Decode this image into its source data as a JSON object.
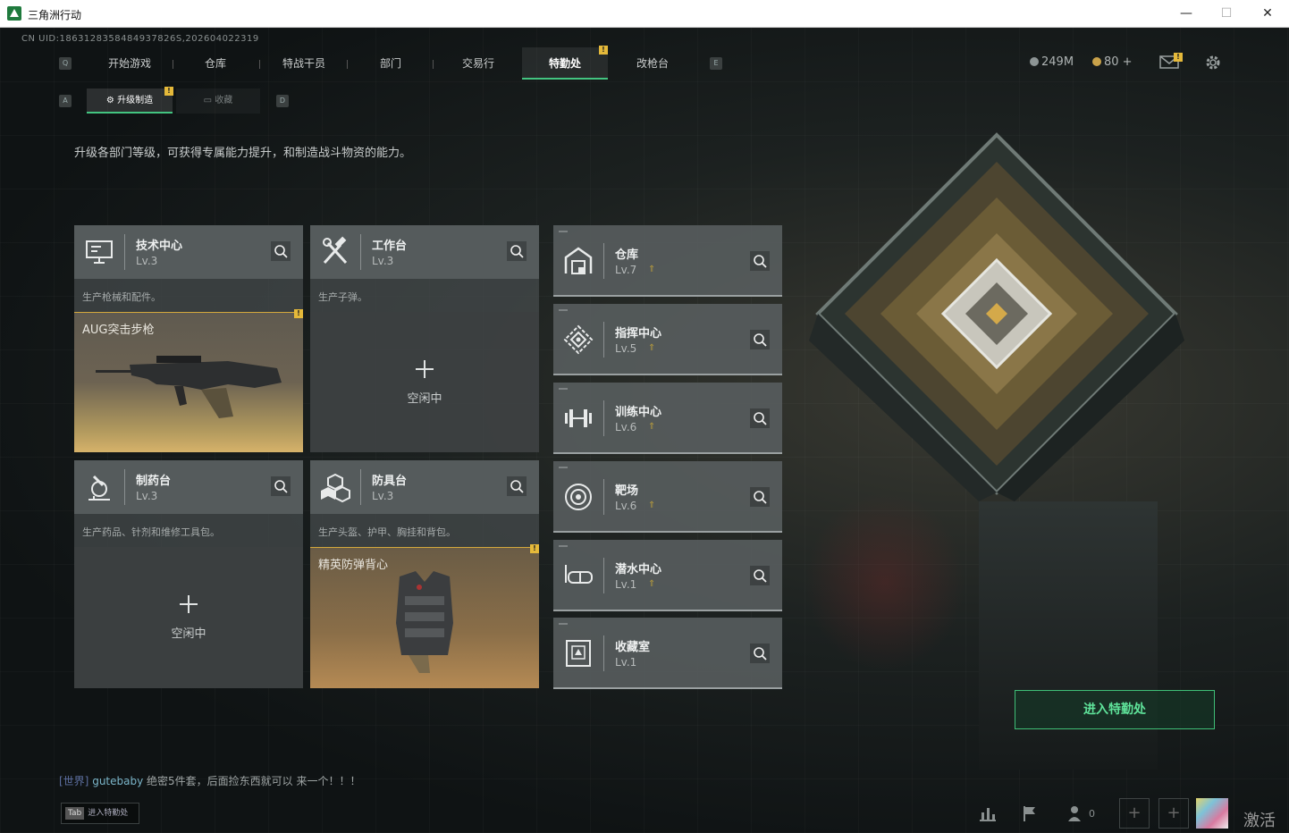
{
  "window": {
    "title": "三角洲行动",
    "minimize": "—",
    "maximize": "☐",
    "close": "✕"
  },
  "uid": "CN UID:1863128358484937826S,202604022319",
  "nav": {
    "left_key": "Q",
    "right_key": "E",
    "items": [
      {
        "label": "开始游戏"
      },
      {
        "label": "仓库"
      },
      {
        "label": "特战干员"
      },
      {
        "label": "部门"
      },
      {
        "label": "交易行"
      },
      {
        "label": "特勤处"
      },
      {
        "label": "改枪台"
      }
    ],
    "alert": "!"
  },
  "resources": {
    "money": "249M",
    "coins": "80 +"
  },
  "subtabs": {
    "left_key": "A",
    "right_key": "D",
    "upgrade": "升级制造",
    "collect": "收藏",
    "alert": "!"
  },
  "description": "升级各部门等级，可获得专属能力提升，和制造战斗物资的能力。",
  "workshops": [
    {
      "title": "技术中心",
      "level": "Lv.3",
      "desc": "生产枪械和配件。",
      "slot": "AUG突击步枪",
      "idle": ""
    },
    {
      "title": "工作台",
      "level": "Lv.3",
      "desc": "生产子弹。",
      "slot": "",
      "idle": "空闲中"
    },
    {
      "title": "制药台",
      "level": "Lv.3",
      "desc": "生产药品、针剂和维修工具包。",
      "slot": "",
      "idle": "空闲中"
    },
    {
      "title": "防具台",
      "level": "Lv.3",
      "desc": "生产头盔、护甲、胸挂和背包。",
      "slot": "精英防弹背心",
      "idle": ""
    }
  ],
  "departments": [
    {
      "title": "仓库",
      "level": "Lv.7"
    },
    {
      "title": "指挥中心",
      "level": "Lv.5"
    },
    {
      "title": "训练中心",
      "level": "Lv.6"
    },
    {
      "title": "靶场",
      "level": "Lv.6"
    },
    {
      "title": "潜水中心",
      "level": "Lv.1"
    },
    {
      "title": "收藏室",
      "level": "Lv.1"
    }
  ],
  "enter_button": "进入特勤处",
  "chat": {
    "channel": "[世界]",
    "user": "gutebaby",
    "message": "绝密5件套，后面捡东西就可以  来一个！！！"
  },
  "tab_hint": {
    "key": "Tab",
    "label": "进入特勤处"
  },
  "friends_count": "0",
  "activate": "激活",
  "colors": {
    "accent": "#43c480",
    "alert": "#e5b93a",
    "gold_slot": "#d6b26a"
  }
}
